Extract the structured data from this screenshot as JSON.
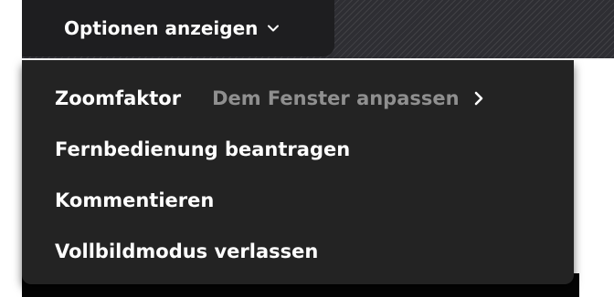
{
  "toolbar": {
    "options_button_label": "Optionen anzeigen",
    "options_button_icon": "chevron-down-icon"
  },
  "menu": {
    "items": [
      {
        "label": "Zoomfaktor",
        "value": "Dem Fenster anpassen",
        "icon": "chevron-right-icon"
      },
      {
        "label": "Fernbedienung beantragen"
      },
      {
        "label": "Kommentieren"
      },
      {
        "label": "Vollbildmodus verlassen"
      }
    ]
  },
  "colors": {
    "menu_background": "#232323",
    "text_primary": "#ffffff",
    "text_secondary": "#8f8f8f",
    "toolbar_background": "#2e2e33"
  }
}
